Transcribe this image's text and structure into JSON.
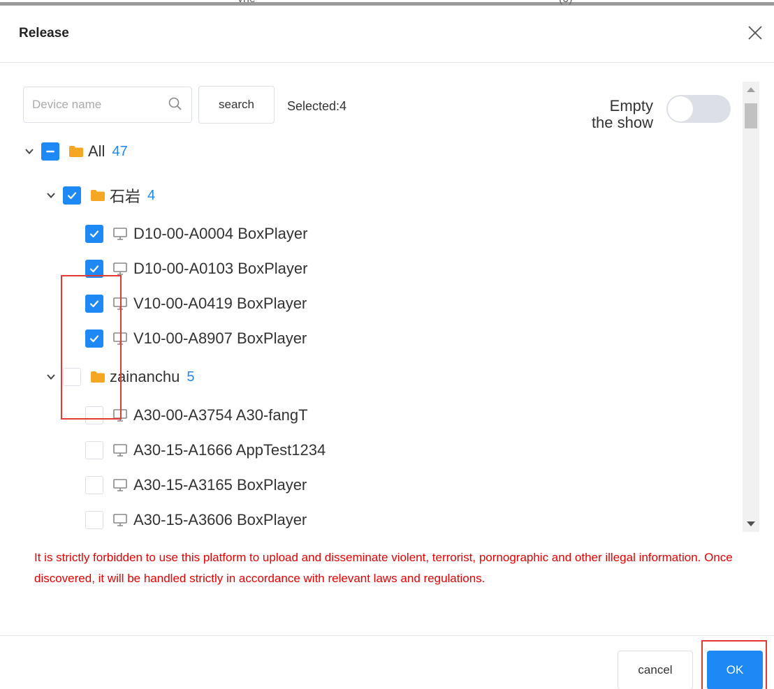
{
  "background_hint": {
    "left": "vne",
    "right": "(0)"
  },
  "dialog": {
    "title": "Release",
    "close_icon": "close-icon"
  },
  "toolbar": {
    "search_placeholder": "Device name",
    "search_value": "",
    "search_button": "search",
    "selected_text": "Selected:4",
    "empty_label_line1": "Empty",
    "empty_label_line2": "the show",
    "empty_toggle_on": false
  },
  "tree": {
    "root": {
      "label": "All",
      "count": "47",
      "state": "indeterminate",
      "expanded": true
    },
    "groups": [
      {
        "label": "石岩",
        "count": "4",
        "state": "checked",
        "expanded": true,
        "devices": [
          {
            "label": "D10-00-A0004 BoxPlayer",
            "checked": true
          },
          {
            "label": "D10-00-A0103 BoxPlayer",
            "checked": true
          },
          {
            "label": "V10-00-A0419 BoxPlayer",
            "checked": true
          },
          {
            "label": "V10-00-A8907 BoxPlayer",
            "checked": true
          }
        ]
      },
      {
        "label": "zainanchu",
        "count": "5",
        "state": "unchecked",
        "expanded": true,
        "devices": [
          {
            "label": "A30-00-A3754 A30-fangT",
            "checked": false
          },
          {
            "label": "A30-15-A1666 AppTest1234",
            "checked": false
          },
          {
            "label": "A30-15-A3165 BoxPlayer",
            "checked": false
          },
          {
            "label": "A30-15-A3606 BoxPlayer",
            "checked": false
          }
        ]
      }
    ]
  },
  "warning": "It is strictly forbidden to use this platform to upload and disseminate violent, terrorist, pornographic and other illegal information. Once discovered, it will be handled strictly in accordance with relevant laws and regulations.",
  "footer": {
    "cancel_label": "cancel",
    "ok_label": "OK"
  },
  "colors": {
    "accent": "#1e88f5",
    "folder": "#f5a623",
    "warning": "#e80000",
    "highlight": "#e53935"
  }
}
